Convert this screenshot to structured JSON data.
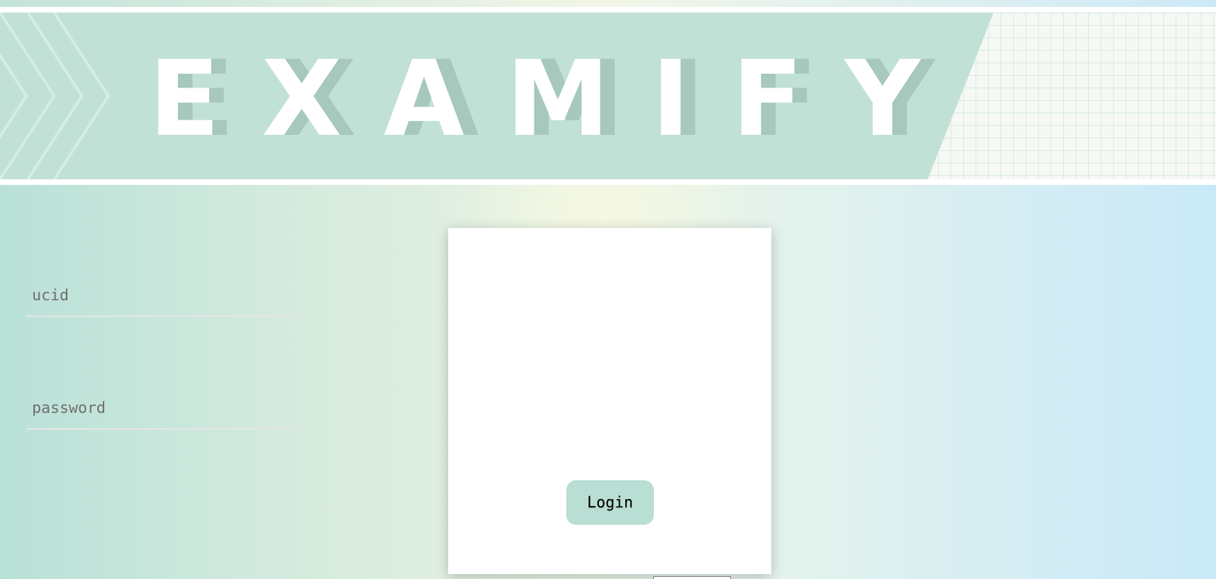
{
  "banner": {
    "logo_text": "EXAMIFY"
  },
  "login_form": {
    "ucid": {
      "placeholder": "ucid",
      "value": ""
    },
    "password": {
      "placeholder": "password",
      "value": ""
    },
    "login_label": "Login"
  },
  "colors": {
    "accent": "#b9ded4",
    "banner": "#c1e1d6",
    "logo": "#ffffff",
    "logo_shadow": "#a6c8be"
  }
}
